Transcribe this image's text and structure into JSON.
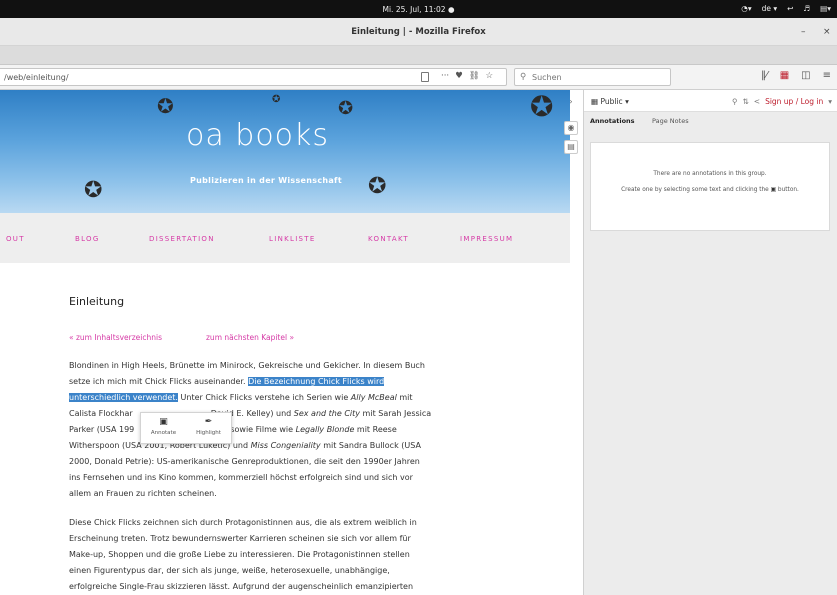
{
  "system": {
    "clock": "Mi. 25. Jul, 11:02 ●",
    "tray": {
      "lang": "de ▾",
      "circle": "▾",
      "sound": "▾",
      "power": "▾"
    }
  },
  "window": {
    "title": "Einleitung | - Mozilla Firefox",
    "minimize": "–",
    "close": "×"
  },
  "navbar": {
    "url": "/web/einleitung/",
    "page_actions": "···",
    "search_placeholder": "Suchen"
  },
  "page": {
    "logo": "oa books",
    "tagline": "Publizieren in der Wissenschaft",
    "menu": [
      "OUT",
      "BLOG",
      "DISSERTATION",
      "LINKLISTE",
      "KONTAKT",
      "IMPRESSUM"
    ],
    "heading": "Einleitung",
    "nav_prev": "« zum Inhaltsverzeichnis",
    "nav_next": "zum nächsten Kapitel »",
    "p1": {
      "l1": "Blondinen in High Heels, Brünette im Minirock, Gekreische und Gekicher. In diesem Buch",
      "l2_a": "setze ich mich mit Chick Flicks auseinander. ",
      "l2_hl": "Die Bezeichnung Chick Flicks wird",
      "l3_hl": "unterschiedlich verwendet.",
      "l3_b": " Unter Chick Flicks verstehe ich Serien wie ",
      "l3_i": "Ally McBeal",
      "l3_c": " mit",
      "l4_a": "Calista Flockhar",
      "l4_b": "David E. Kelley) und ",
      "l4_i": "Sex and the City",
      "l4_c": " mit Sarah Jessica",
      "l5_a": "Parker (USA 199",
      "l5_b": "rr) sowie Filme wie ",
      "l5_i": "Legally Blonde",
      "l5_c": " mit Reese",
      "l6_a": "Witherspoon (USA 2001, Robert Luketic) und ",
      "l6_i": "Miss Congeniality",
      "l6_b": " mit Sandra Bullock (USA",
      "l7": "2000, Donald Petrie): US-amerikanische Genreproduktionen, die seit den 1990er Jahren",
      "l8": "ins Fernsehen und ins Kino kommen, kommerziell höchst erfolgreich sind und sich vor",
      "l9": "allem an Frauen zu richten scheinen."
    },
    "p2": {
      "l1": "Diese Chick Flicks zeichnen sich durch Protagonistinnen aus, die als extrem weiblich in",
      "l2": "Erscheinung treten. Trotz bewundernswerter Karrieren scheinen sie sich vor allem für",
      "l3": "Make-up, Shoppen und die große Liebe zu interessieren. Die Protagonistinnen stellen",
      "l4": "einen Figurentypus dar, der sich als junge, weiße, heterosexuelle, unabhängige,",
      "l5": "erfolgreiche Single-Frau skizzieren lässt. Aufgrund der augenscheinlich emanzipierten"
    }
  },
  "adder": {
    "annotate": "Annotate",
    "highlight": "Highlight"
  },
  "sidebar": {
    "group": "Public ▾",
    "login": "Sign up / Log in",
    "tab_annotations": "Annotations",
    "tab_page_notes": "Page Notes",
    "empty_line1": "There are no annotations in this group.",
    "empty_line2_a": "Create one by selecting some text and clicking the ",
    "empty_line2_b": " button."
  },
  "icons": {
    "adder_annotate": "annotate-icon",
    "adder_highlight": "highlight-icon",
    "search": "search-icon",
    "share": "share-icon"
  }
}
